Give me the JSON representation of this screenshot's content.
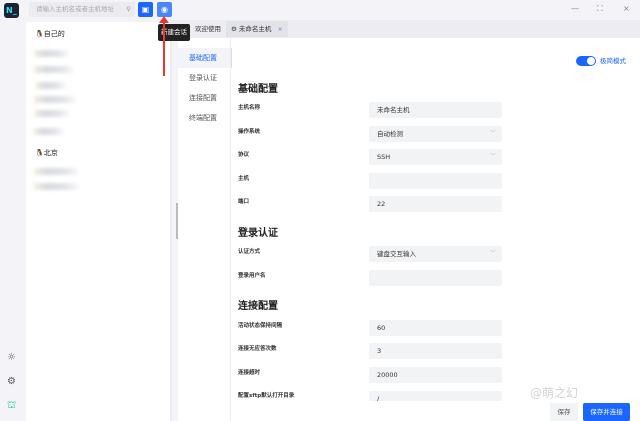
{
  "app": {
    "logo": "N_",
    "search_placeholder": "请输入主机名或者主机地址",
    "new_session_tooltip": "新建会话"
  },
  "window": {
    "minimize": "—",
    "maximize": "⛶",
    "close": "×"
  },
  "hostlist": {
    "groups": [
      {
        "label": "自己的"
      },
      {
        "label": "北京"
      }
    ]
  },
  "tabs": [
    {
      "label": "欢迎使用"
    },
    {
      "label": "未命名主机",
      "close": "×"
    }
  ],
  "nav": [
    "基础配置",
    "登录认证",
    "连接配置",
    "终端配置"
  ],
  "toggle": {
    "label": "极简模式",
    "on": true
  },
  "sections": {
    "basic": {
      "title": "基础配置",
      "fields": [
        {
          "label": "主机名称",
          "value": "未命名主机"
        },
        {
          "label": "操作系统",
          "value": "自动检测"
        },
        {
          "label": "协议",
          "value": "SSH"
        },
        {
          "label": "主机",
          "value": ""
        },
        {
          "label": "端口",
          "value": "22"
        }
      ]
    },
    "auth": {
      "title": "登录认证",
      "fields": [
        {
          "label": "认证方式",
          "value": "键盘交互输入"
        },
        {
          "label": "登录用户名",
          "value": ""
        }
      ]
    },
    "conn": {
      "title": "连接配置",
      "fields": [
        {
          "label": "活动状态保持间隔",
          "value": "60"
        },
        {
          "label": "连接无应答次数",
          "value": "3"
        },
        {
          "label": "连接超时",
          "value": "20000"
        },
        {
          "label": "配置sftp默认打开目录",
          "value": "/"
        }
      ]
    }
  },
  "buttons": {
    "save": "保存",
    "save_connect": "保存并连接"
  },
  "watermark": "@萌之幻"
}
